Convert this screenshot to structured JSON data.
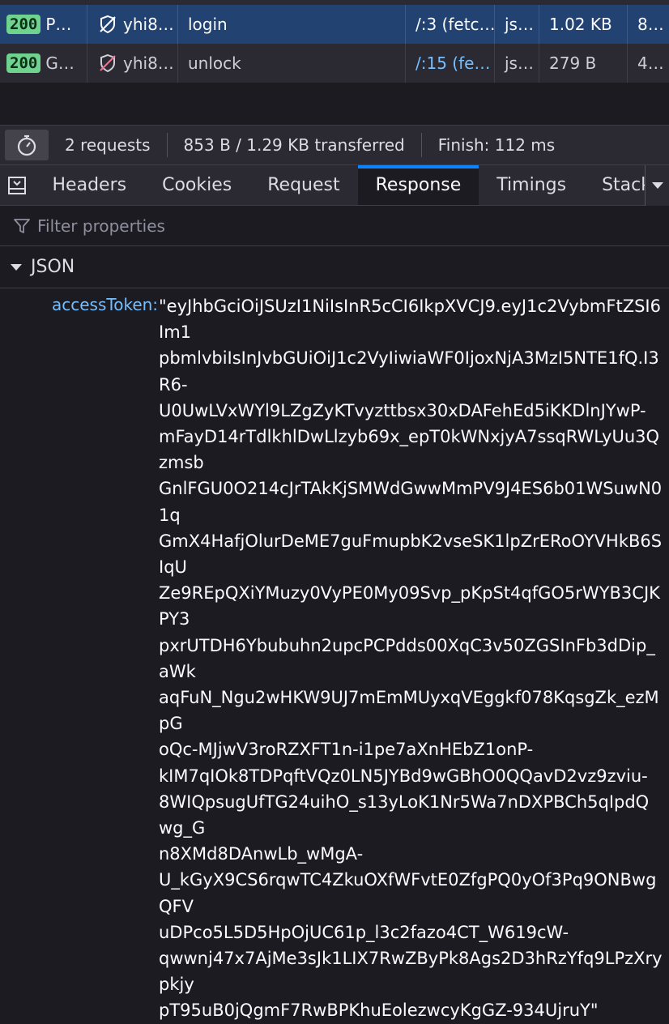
{
  "requests": [
    {
      "status": "200",
      "method": "P…",
      "domain": "yhi8…",
      "file": "login",
      "initiator_prefix": "",
      "initiator": "/:3 (fetc…",
      "type": "js…",
      "transferred": "1.02 KB",
      "size": "8…",
      "selected": true
    },
    {
      "status": "200",
      "method": "G…",
      "domain": "yhi8…",
      "file": "unlock",
      "initiator_prefix": "/",
      "initiator": ":15 (fe…",
      "type": "js…",
      "transferred": "279 B",
      "size": "4…",
      "selected": false
    }
  ],
  "summary": {
    "requests": "2 requests",
    "transferred": "853 B / 1.29 KB transferred",
    "finish": "Finish: 112 ms"
  },
  "tabs": [
    "Headers",
    "Cookies",
    "Request",
    "Response",
    "Timings",
    "Stack"
  ],
  "active_tab": "Response",
  "filter": {
    "placeholder": "Filter properties"
  },
  "json_section": {
    "label": "JSON"
  },
  "property": {
    "key": "accessToken:",
    "lines": [
      "\"eyJhbGciOiJSUzI1NiIsInR5cCI6IkpXVCJ9.eyJ1c2VybmFtZSI6Im1",
      "pbmlvbiIsInJvbGUiOiJ1c2VyIiwiaWF0IjoxNjA3MzI5NTE1fQ.I3R6-",
      "U0UwLVxWYl9LZgZyKTvyzttbsx30xDAFehEd5iKKDlnJYwP-",
      "mFayD14rTdlkhlDwLlzyb69x_epT0kWNxjyA7ssqRWLyUu3Qzmsb",
      "GnlFGU0O214cJrTAkKjSMWdGwwMmPV9J4ES6b01WSuwN01q",
      "GmX4HafjOlurDeME7guFmupbK2vseSK1lpZrERoOYVHkB6SIqU",
      "Ze9REpQXiYMuzy0VyPE0My09Svp_pKpSt4qfGO5rWYB3CJKPY3",
      "pxrUTDH6Ybubuhn2upcPCPdds00XqC3v50ZGSInFb3dDip_aWk",
      "aqFuN_Ngu2wHKW9UJ7mEmMUyxqVEggkf078KqsgZk_ezMpG",
      "oQc-MJjwV3roRZXFT1n-i1pe7aXnHEbZ1onP-",
      "kIM7qIOk8TDPqftVQz0LN5JYBd9wGBhO0QQavD2vz9zviu-",
      "8WIQpsugUfTG24uihO_s13yLoK1Nr5Wa7nDXPBCh5qIpdQwg_G",
      "n8XMd8DAnwLb_wMgA-",
      "U_kGyX9CS6rqwTC4ZkuOXfWFvtE0ZfgPQ0yOf3Pq9ONBwgQFV",
      "uDPco5L5D5HpOjUC61p_l3c2fazo4CT_W619cW-",
      "qwwnj47x7AjMe3sJk1LIX7RwZByPk8Ags2D3hRzYfq9LPzXrypkjy",
      "pT95uB0jQgmF7RwBPKhuEolezwcyKgGZ-934UjruY\""
    ]
  },
  "icons": {
    "tracking": "tracking-protection-icon",
    "stopwatch": "stopwatch-icon",
    "panel": "panel-toggle-icon",
    "overflow": "chevron-down-icon",
    "filter": "filter-icon",
    "twisty": "twisty-expanded-icon"
  },
  "colors": {
    "accent": "#0a84ff",
    "status_ok": "#6fd38f",
    "key_color": "#75bfff",
    "selected_row": "#224271",
    "background": "#1c1b22"
  }
}
